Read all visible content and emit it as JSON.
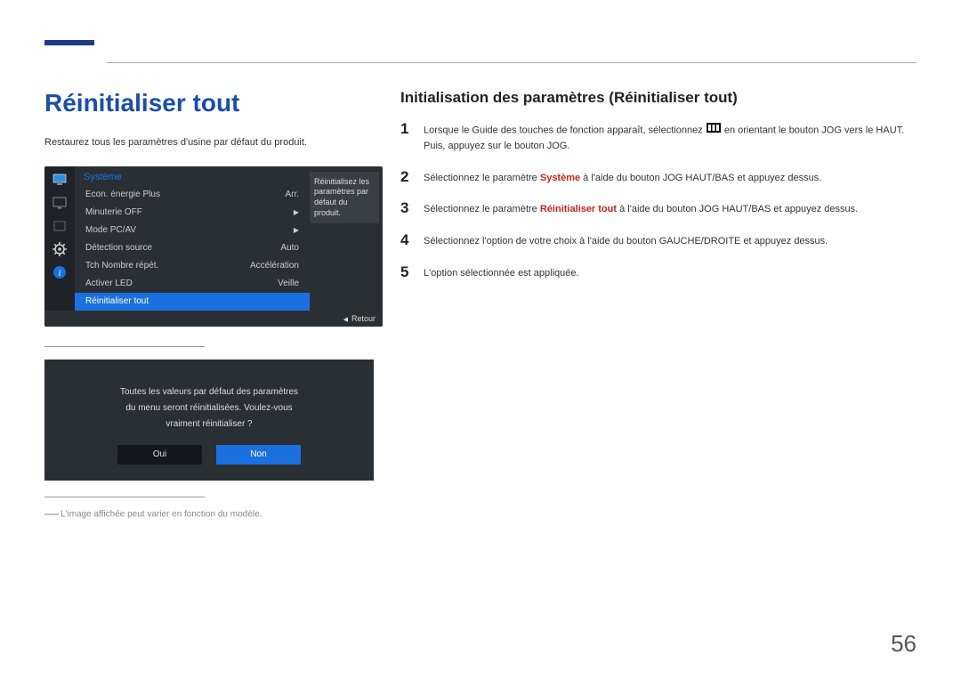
{
  "page_number": "56",
  "main_title": "Réinitialiser tout",
  "intro": "Restaurez tous les paramètres d'usine par défaut du produit.",
  "osd": {
    "header": "Système",
    "tooltip": "Réinitialisez les paramètres par défaut du produit.",
    "rows": [
      {
        "label": "Econ. énergie Plus",
        "value": "Arr."
      },
      {
        "label": "Minuterie OFF",
        "value": "▶"
      },
      {
        "label": "Mode PC/AV",
        "value": "▶"
      },
      {
        "label": "Détection source",
        "value": "Auto"
      },
      {
        "label": "Tch Nombre répét.",
        "value": "Accélération"
      },
      {
        "label": "Activer LED",
        "value": "Veille"
      },
      {
        "label": "Réinitialiser tout",
        "value": ""
      }
    ],
    "footer": "Retour",
    "icons": [
      "monitor-icon",
      "tv-icon",
      "blank-icon",
      "gear-icon",
      "info-icon"
    ]
  },
  "dialog": {
    "message": "Toutes les valeurs par défaut des paramètres\ndu menu seront réinitialisées. Voulez-vous\nvraiment réinitialiser ?",
    "yes": "Oui",
    "no": "Non"
  },
  "note": "L'image affichée peut varier en fonction du modèle.",
  "sub_title": "Initialisation des paramètres (Réinitialiser tout)",
  "steps": {
    "s1_a": "Lorsque le Guide des touches de fonction apparaît, sélectionnez ",
    "s1_b": " en orientant le bouton JOG vers le HAUT. Puis, appuyez sur le bouton JOG.",
    "s2_a": "Sélectionnez le paramètre ",
    "s2_hl": "Système",
    "s2_b": " à l'aide du bouton JOG HAUT/BAS et appuyez dessus.",
    "s3_a": "Sélectionnez le paramètre ",
    "s3_hl": "Réinitialiser tout",
    "s3_b": " à l'aide du bouton JOG HAUT/BAS et appuyez dessus.",
    "s4": "Sélectionnez l'option de votre choix à l'aide du bouton GAUCHE/DROITE et appuyez dessus.",
    "s5": "L'option sélectionnée est appliquée."
  }
}
